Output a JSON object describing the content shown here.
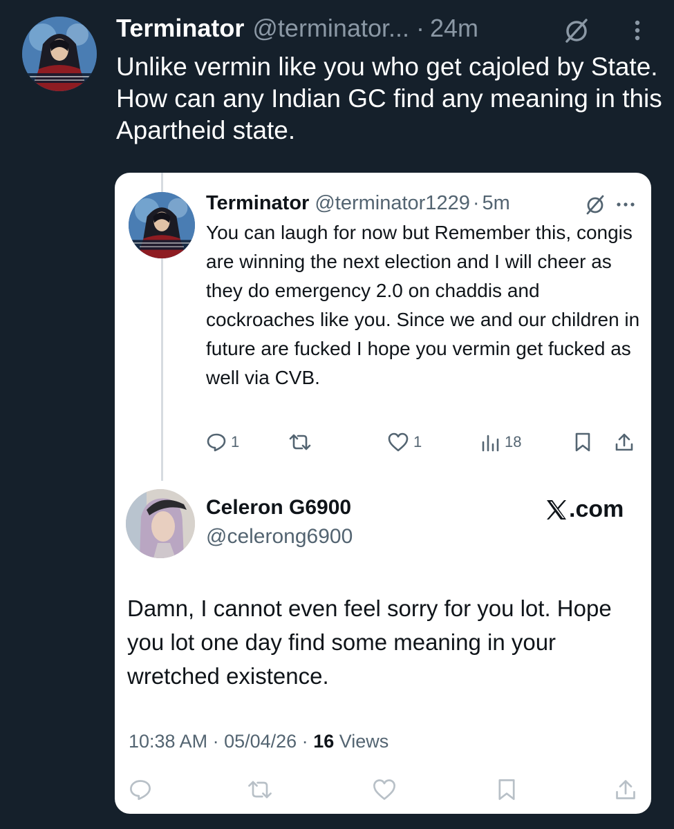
{
  "outer_tweet": {
    "display_name": "Terminator",
    "handle": "@terminator...",
    "separator": "·",
    "time": "24m",
    "text": "Unlike vermin like you who get cajoled by State. How can any Indian GC find any meaning in this Apartheid state."
  },
  "reply_tweet": {
    "display_name": "Terminator",
    "handle": "@terminator1229",
    "separator": "·",
    "time": "5m",
    "text": "You can laugh for now but Remember this, congis are winning the next election and I will cheer as they do emergency 2.0 on chaddis and cockroaches like you. Since we and our children in future are fucked I hope you vermin get fucked as well via CVB.",
    "actions": {
      "replies": "1",
      "likes": "1",
      "views": "18"
    }
  },
  "quoted_tweet": {
    "display_name": "Celeron G6900",
    "handle": "@celerong6900",
    "brand": ".com",
    "text": "Damn, I cannot even feel sorry for you lot. Hope you lot one day find some meaning in your wretched existence.",
    "timestamp": "10:38 AM · 05/04/26 ·",
    "views_count": "16",
    "views_label": "Views"
  },
  "icons": {
    "badge": "slash-circle-icon",
    "more": "more-dots-icon",
    "reply": "reply-icon",
    "repost": "repost-icon",
    "like": "heart-icon",
    "views": "bar-chart-icon",
    "bookmark": "bookmark-icon",
    "share": "share-icon"
  },
  "colors": {
    "background": "#15202b",
    "card": "#ffffff",
    "secondary_text_dark": "#8b98a5",
    "secondary_text_light": "#536471",
    "faded_icon": "#b8c0c7"
  }
}
